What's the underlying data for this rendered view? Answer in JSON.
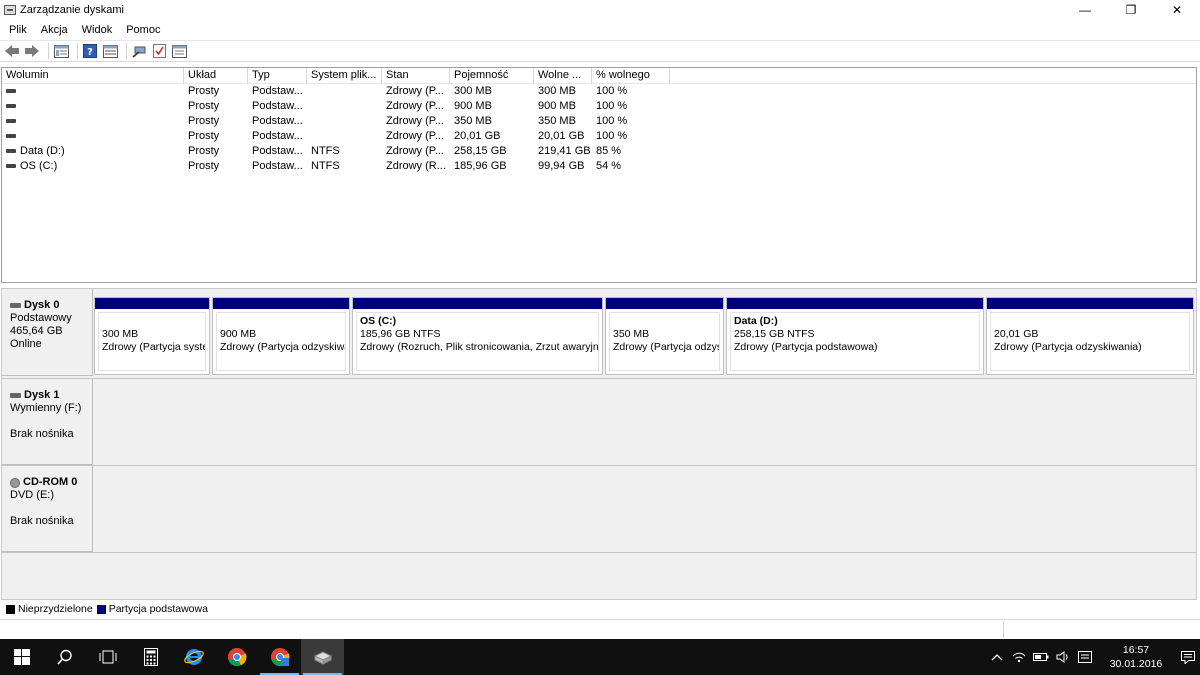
{
  "window": {
    "title": "Zarządzanie dyskami",
    "minimize": "—",
    "restore": "❐",
    "close": "✕"
  },
  "menu": [
    "Plik",
    "Akcja",
    "Widok",
    "Pomoc"
  ],
  "toolbar_icons": [
    "back-arrow-icon",
    "forward-arrow-icon",
    "list-view-icon",
    "help-icon",
    "properties-icon",
    "connect-icon",
    "checklist-icon",
    "settings-panel-icon"
  ],
  "volume_table": {
    "headers": [
      "Wolumin",
      "Układ",
      "Typ",
      "System plik...",
      "Stan",
      "Pojemność",
      "Wolne ...",
      "% wolnego"
    ],
    "rows": [
      [
        "",
        "Prosty",
        "Podstaw...",
        "",
        "Zdrowy (P...",
        "300 MB",
        "300 MB",
        "100 %"
      ],
      [
        "",
        "Prosty",
        "Podstaw...",
        "",
        "Zdrowy (P...",
        "900 MB",
        "900 MB",
        "100 %"
      ],
      [
        "",
        "Prosty",
        "Podstaw...",
        "",
        "Zdrowy (P...",
        "350 MB",
        "350 MB",
        "100 %"
      ],
      [
        "",
        "Prosty",
        "Podstaw...",
        "",
        "Zdrowy (P...",
        "20,01 GB",
        "20,01 GB",
        "100 %"
      ],
      [
        "Data (D:)",
        "Prosty",
        "Podstaw...",
        "NTFS",
        "Zdrowy (P...",
        "258,15 GB",
        "219,41 GB",
        "85 %"
      ],
      [
        "OS (C:)",
        "Prosty",
        "Podstaw...",
        "NTFS",
        "Zdrowy (R...",
        "185,96 GB",
        "99,94 GB",
        "54 %"
      ]
    ]
  },
  "disks": [
    {
      "name": "Dysk 0",
      "line1": "Podstawowy",
      "line2": "465,64 GB",
      "line3": "Online",
      "partitions": [
        {
          "name": "",
          "size": "300 MB",
          "status": "Zdrowy (Partycja syste"
        },
        {
          "name": "",
          "size": "900 MB",
          "status": "Zdrowy (Partycja odzyskiwa"
        },
        {
          "name": "OS  (C:)",
          "size": "185,96 GB NTFS",
          "status": "Zdrowy (Rozruch, Plik stronicowania, Zrzut awaryjny"
        },
        {
          "name": "",
          "size": "350 MB",
          "status": "Zdrowy (Partycja odzys"
        },
        {
          "name": "Data  (D:)",
          "size": "258,15 GB NTFS",
          "status": "Zdrowy (Partycja podstawowa)"
        },
        {
          "name": "",
          "size": "20,01 GB",
          "status": "Zdrowy (Partycja odzyskiwania)"
        }
      ]
    },
    {
      "name": "Dysk 1",
      "line1": "Wymienny (F:)",
      "line2": "",
      "line3": "Brak nośnika"
    },
    {
      "name": "CD-ROM 0",
      "line1": "DVD (E:)",
      "line2": "",
      "line3": "Brak nośnika"
    }
  ],
  "legend": [
    {
      "label": "Nieprzydzielone",
      "color": "#000000"
    },
    {
      "label": "Partycja podstawowa",
      "color": "#00007b"
    }
  ],
  "taskbar": {
    "time": "16:57",
    "date": "30.01.2016"
  }
}
